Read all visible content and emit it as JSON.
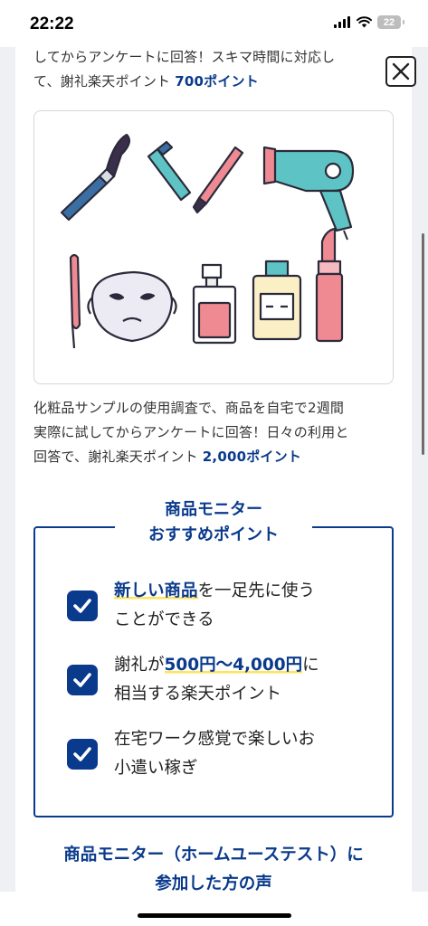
{
  "status_bar": {
    "time": "22:22",
    "battery": "22"
  },
  "intro": {
    "line1": "してからアンケートに回答！スキマ時間に対応し",
    "line2_prefix": "て、謝礼楽天ポイント ",
    "line2_points": "700ポイント"
  },
  "close_label": "✕",
  "description": {
    "line1": "化粧品サンプルの使用調査で、商品を自宅で2週間",
    "line2": "実際に試してからアンケートに回答！日々の利用と",
    "line3_prefix": "回答で、謝礼楽天ポイント ",
    "line3_points": "2,000ポイント"
  },
  "recommend": {
    "title_line1": "商品モニター",
    "title_line2": "おすすめポイント",
    "items": [
      {
        "hl": "新しい商品",
        "rest1": "を一足先に使う",
        "line2": "ことができる"
      },
      {
        "pre": "謝礼が",
        "hl": "500円〜4,000円",
        "rest1": "に",
        "line2": "相当する楽天ポイント"
      },
      {
        "line1": "在宅ワーク感覚で楽しいお",
        "line2": "小遣い稼ぎ"
      }
    ]
  },
  "voices": {
    "title_line1": "商品モニター（ホームユーステスト）に",
    "title_line2": "参加した方の声"
  },
  "colors": {
    "brand": "#0a3a8c",
    "highlight": "#ffe45c",
    "illust_pink": "#ef8a93",
    "illust_teal": "#5ec3c4",
    "illust_blue": "#3b6fa3"
  },
  "icons": [
    "signal-icon",
    "wifi-icon",
    "battery-icon",
    "close-icon",
    "check-icon",
    "makeup-brush-icon",
    "eyeliner-icon",
    "hair-dryer-icon",
    "curling-iron-icon",
    "face-mask-icon",
    "perfume-icon",
    "lotion-bottle-icon",
    "lipstick-icon"
  ]
}
